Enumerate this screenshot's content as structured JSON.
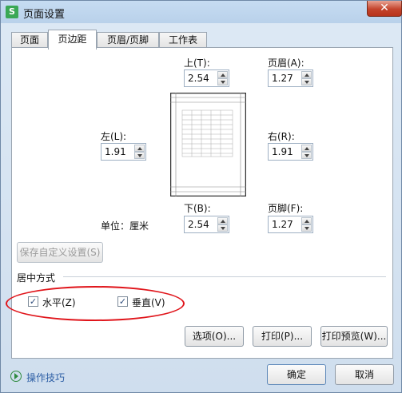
{
  "window": {
    "title": "页面设置",
    "app_icon": "S",
    "close_symbol": "✕"
  },
  "tabs": [
    {
      "label": "页面",
      "active": false
    },
    {
      "label": "页边距",
      "active": true
    },
    {
      "label": "页眉/页脚",
      "active": false
    },
    {
      "label": "工作表",
      "active": false
    }
  ],
  "margins": {
    "top": {
      "label": "上(T):",
      "value": "2.54"
    },
    "header": {
      "label": "页眉(A):",
      "value": "1.27"
    },
    "left": {
      "label": "左(L):",
      "value": "1.91"
    },
    "right": {
      "label": "右(R):",
      "value": "1.91"
    },
    "bottom": {
      "label": "下(B):",
      "value": "2.54"
    },
    "footer": {
      "label": "页脚(F):",
      "value": "1.27"
    },
    "unit_label": "单位：厘米"
  },
  "save_custom_button": "保存自定义设置(S)",
  "center": {
    "group_label": "居中方式",
    "horizontal": {
      "label": "水平(Z)",
      "checked": true
    },
    "vertical": {
      "label": "垂直(V)",
      "checked": true
    }
  },
  "buttons": {
    "options": "选项(O)...",
    "print": "打印(P)...",
    "print_preview": "打印预览(W)...",
    "ok": "确定",
    "cancel": "取消"
  },
  "tips_link": "操作技巧",
  "colors": {
    "annotation_ellipse": "#e0151b",
    "tips_link": "#2e5fa5"
  }
}
